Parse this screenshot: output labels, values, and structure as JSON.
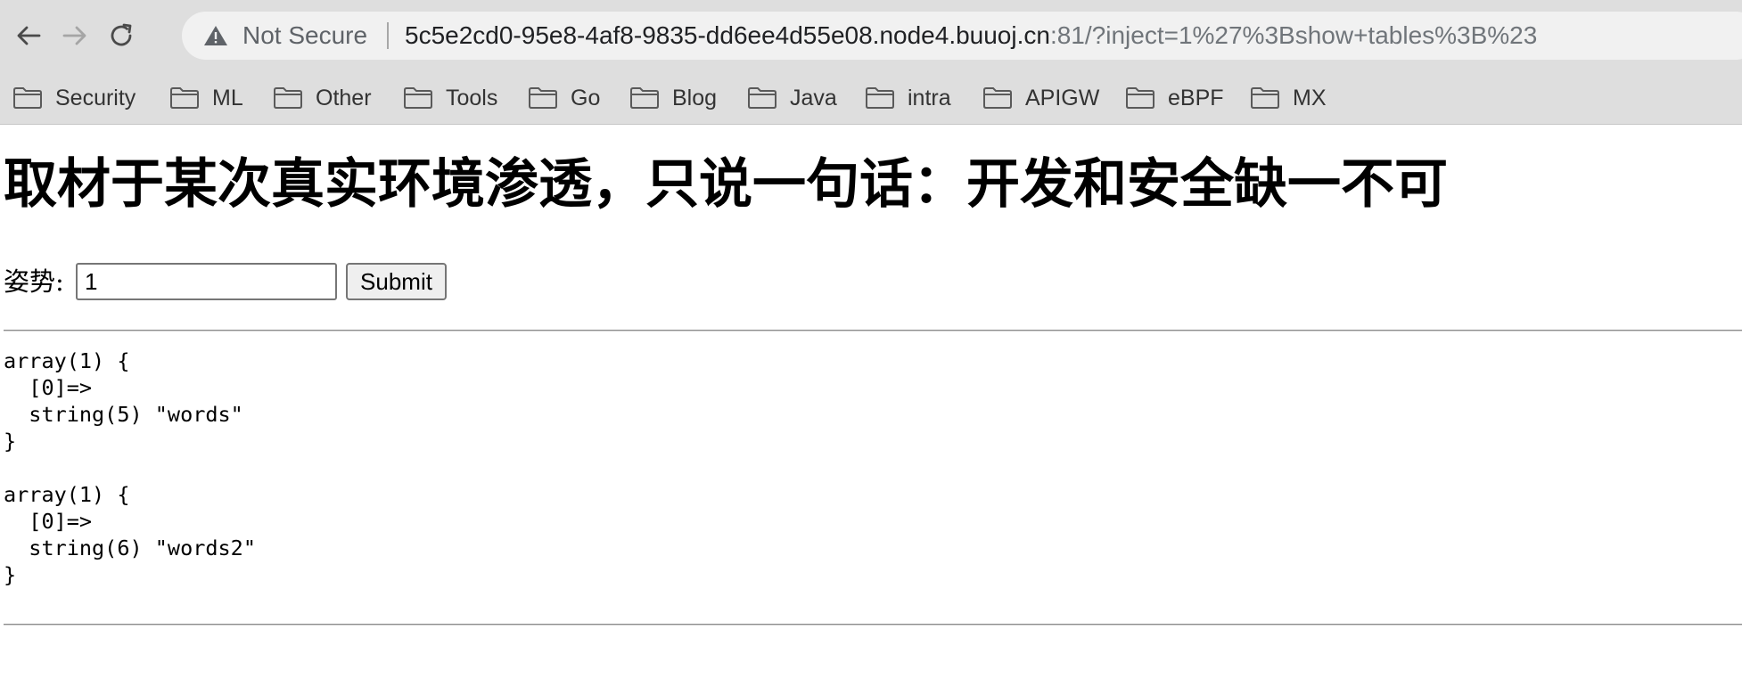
{
  "browser": {
    "security_label": "Not Secure",
    "url_host": "5c5e2cd0-95e8-4af8-9835-dd6ee4d55e08.node4.buuoj.cn",
    "url_rest": ":81/?inject=1%27%3Bshow+tables%3B%23",
    "icons": {
      "back": "back-arrow-icon",
      "forward": "forward-arrow-icon",
      "reload": "reload-icon",
      "warning": "warning-triangle-icon",
      "folder": "folder-icon"
    }
  },
  "bookmarks": [
    {
      "label": "Security"
    },
    {
      "label": "ML"
    },
    {
      "label": "Other"
    },
    {
      "label": "Tools"
    },
    {
      "label": "Go"
    },
    {
      "label": "Blog"
    },
    {
      "label": "Java"
    },
    {
      "label": "intra"
    },
    {
      "label": "APIGW"
    },
    {
      "label": "eBPF"
    },
    {
      "label": "MX"
    }
  ],
  "page": {
    "title": "取材于某次真实环境渗透，只说一句话：开发和安全缺一不可",
    "form_label": "姿势:",
    "input_value": "1",
    "submit_label": "Submit",
    "output": "array(1) {\n  [0]=>\n  string(5) \"words\"\n}\n\narray(1) {\n  [0]=>\n  string(6) \"words2\"\n}"
  },
  "colors": {
    "chrome_background": "#dedede",
    "omnibox_background": "#f1f1f1",
    "url_host": "#202124",
    "url_rest": "#70757a"
  }
}
